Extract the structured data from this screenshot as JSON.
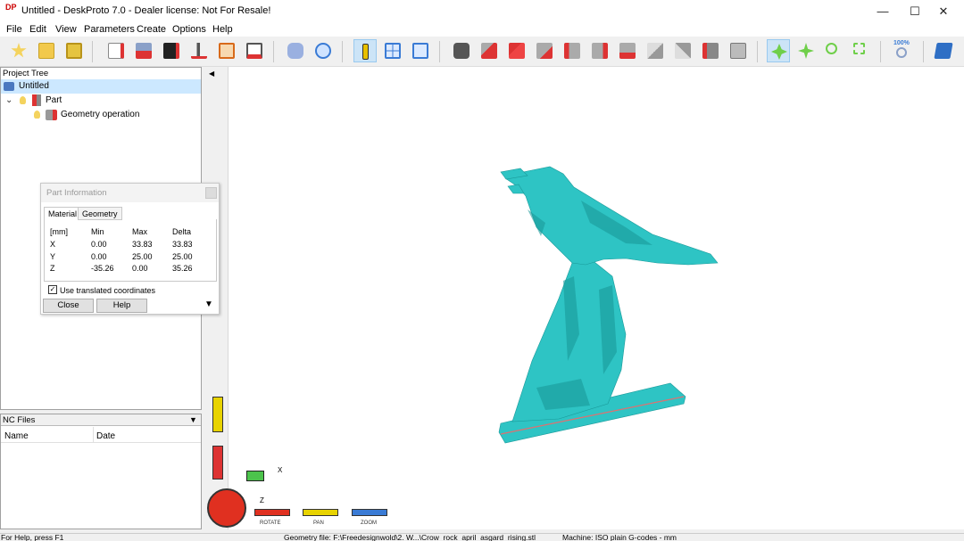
{
  "window": {
    "app_icon": "DP",
    "title": "Untitled - DeskProto 7.0 - Dealer license: Not For Resale!",
    "minimize": "—",
    "maximize": "☐",
    "close": "✕"
  },
  "menu": [
    "File",
    "Edit",
    "View",
    "Parameters",
    "Create",
    "Options",
    "Help"
  ],
  "toolbar_icons": [
    "new-project-icon",
    "open-project-icon",
    "save-project-icon",
    "load-geometry-icon",
    "import-part-icon",
    "load-bitmap-icon",
    "split-icon",
    "load-dxf-icon",
    "save-geometry-icon",
    "select-cursor-icon",
    "search-icon",
    "info-icon",
    "layout-icon",
    "preview-icon",
    "camera-icon",
    "view-front-icon",
    "view-top-icon",
    "view-back-icon",
    "view-left-icon",
    "view-right-icon",
    "view-bottom-icon",
    "view-iso-icon",
    "view-iso2-icon",
    "reset-view-icon",
    "print-icon",
    "rotate-tool-icon",
    "pan-tool-icon",
    "zoom-tool-icon",
    "zoom-window-icon",
    "zoom-100-icon",
    "help-book-icon"
  ],
  "toolbar_zoom_label": "100%",
  "project_tree": {
    "header": "Project Tree",
    "items": [
      {
        "label": "Untitled",
        "icon": "project-icon"
      },
      {
        "label": "Part",
        "icon": "part-icon"
      },
      {
        "label": "Geometry operation",
        "icon": "geometry-operation-icon"
      }
    ]
  },
  "part_info": {
    "title": "Part Information",
    "tabs": [
      "Material",
      "Geometry"
    ],
    "headers": [
      "[mm]",
      "Min",
      "Max",
      "Delta"
    ],
    "rows": [
      [
        "X",
        "0.00",
        "33.83",
        "33.83"
      ],
      [
        "Y",
        "0.00",
        "25.00",
        "25.00"
      ],
      [
        "Z",
        "-35.26",
        "0.00",
        "35.26"
      ]
    ],
    "checkbox_label": "Use translated coordinates",
    "checkbox_checked": true,
    "close_label": "Close",
    "help_label": "Help"
  },
  "nc_files": {
    "header": "NC Files",
    "columns": [
      "Name",
      "Date"
    ]
  },
  "viewport": {
    "model_color": "#2ec4c4",
    "axis_x": "X",
    "axis_z": "Z",
    "dials": [
      "ROTATE",
      "PAN",
      "ZOOM"
    ]
  },
  "status": {
    "help": "For Help, press F1",
    "geometry": "Geometry file: F:\\Freedesignwold\\2. W...\\Crow_rock_april_asgard_rising.stl",
    "machine": "Machine: ISO plain G-codes - mm"
  }
}
